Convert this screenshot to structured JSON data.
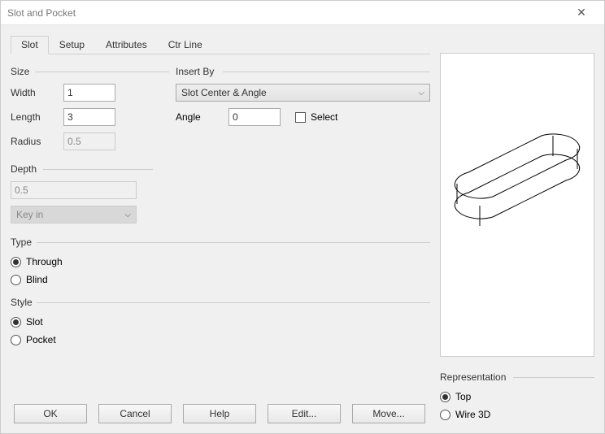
{
  "window": {
    "title": "Slot and Pocket"
  },
  "tabs": [
    "Slot",
    "Setup",
    "Attributes",
    "Ctr Line"
  ],
  "active_tab": 0,
  "size": {
    "legend": "Size",
    "width_label": "Width",
    "width_value": "1",
    "length_label": "Length",
    "length_value": "3",
    "radius_label": "Radius",
    "radius_value": "0.5"
  },
  "insert_by": {
    "legend": "Insert By",
    "mode_value": "Slot Center & Angle",
    "angle_label": "Angle",
    "angle_value": "0",
    "select_label": "Select",
    "select_checked": false
  },
  "depth": {
    "legend": "Depth",
    "value": "0.5",
    "method_value": "Key in"
  },
  "type": {
    "legend": "Type",
    "options": [
      "Through",
      "Blind"
    ],
    "selected": "Through"
  },
  "style": {
    "legend": "Style",
    "options": [
      "Slot",
      "Pocket"
    ],
    "selected": "Slot"
  },
  "representation": {
    "legend": "Representation",
    "options": [
      "Top",
      "Wire 3D"
    ],
    "selected": "Top"
  },
  "buttons": {
    "ok": "OK",
    "cancel": "Cancel",
    "help": "Help",
    "edit": "Edit...",
    "move": "Move..."
  }
}
